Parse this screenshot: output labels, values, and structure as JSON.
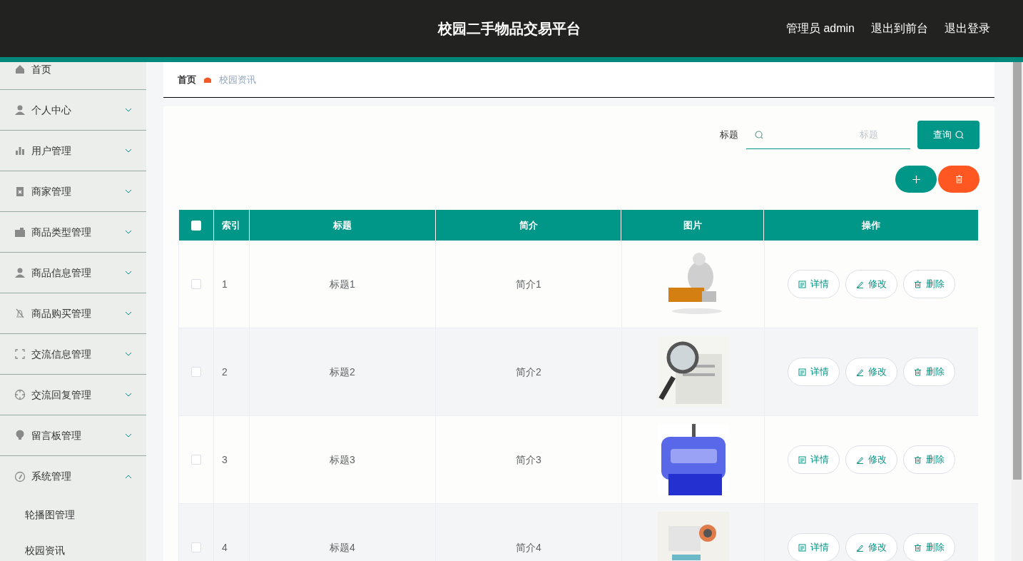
{
  "header": {
    "title": "校园二手物品交易平台",
    "links": [
      "管理员 admin",
      "退出到前台",
      "退出登录"
    ]
  },
  "sidebar": {
    "items": [
      {
        "label": "首页"
      },
      {
        "label": "个人中心",
        "expanded": false
      },
      {
        "label": "用户管理",
        "expanded": false
      },
      {
        "label": "商家管理",
        "expanded": false
      },
      {
        "label": "商品类型管理",
        "expanded": false
      },
      {
        "label": "商品信息管理",
        "expanded": false
      },
      {
        "label": "商品购买管理",
        "expanded": false
      },
      {
        "label": "交流信息管理",
        "expanded": false
      },
      {
        "label": "交流回复管理",
        "expanded": false
      },
      {
        "label": "留言板管理",
        "expanded": false
      },
      {
        "label": "系统管理",
        "expanded": true,
        "children": [
          {
            "label": "轮播图管理"
          },
          {
            "label": "校园资讯"
          }
        ]
      }
    ]
  },
  "breadcrumb": [
    "首页",
    "校园资讯"
  ],
  "search": {
    "label": "标题",
    "placeholder": "标题",
    "button": "查询"
  },
  "table": {
    "columns": [
      "索引",
      "标题",
      "简介",
      "图片",
      "操作"
    ],
    "select_all_checked": false,
    "rows": [
      {
        "index": "1",
        "title": "标题1",
        "intro": "简介1",
        "checked": false,
        "picture": {
          "kind": "picture"
        },
        "actions": [
          "详情",
          "修改",
          "删除"
        ]
      },
      {
        "index": "2",
        "title": "标题2",
        "intro": "简介2",
        "checked": false,
        "picture": {
          "kind": "picture"
        },
        "actions": [
          "详情",
          "修改",
          "删除"
        ]
      },
      {
        "index": "3",
        "title": "标题3",
        "intro": "简介3",
        "checked": false,
        "picture": {
          "kind": "picture"
        },
        "actions": [
          "详情",
          "修改",
          "删除"
        ]
      },
      {
        "index": "4",
        "title": "标题4",
        "intro": "简介4",
        "checked": false,
        "picture": {
          "kind": "picture"
        },
        "actions": [
          "详情",
          "修改",
          "删除"
        ]
      }
    ]
  }
}
